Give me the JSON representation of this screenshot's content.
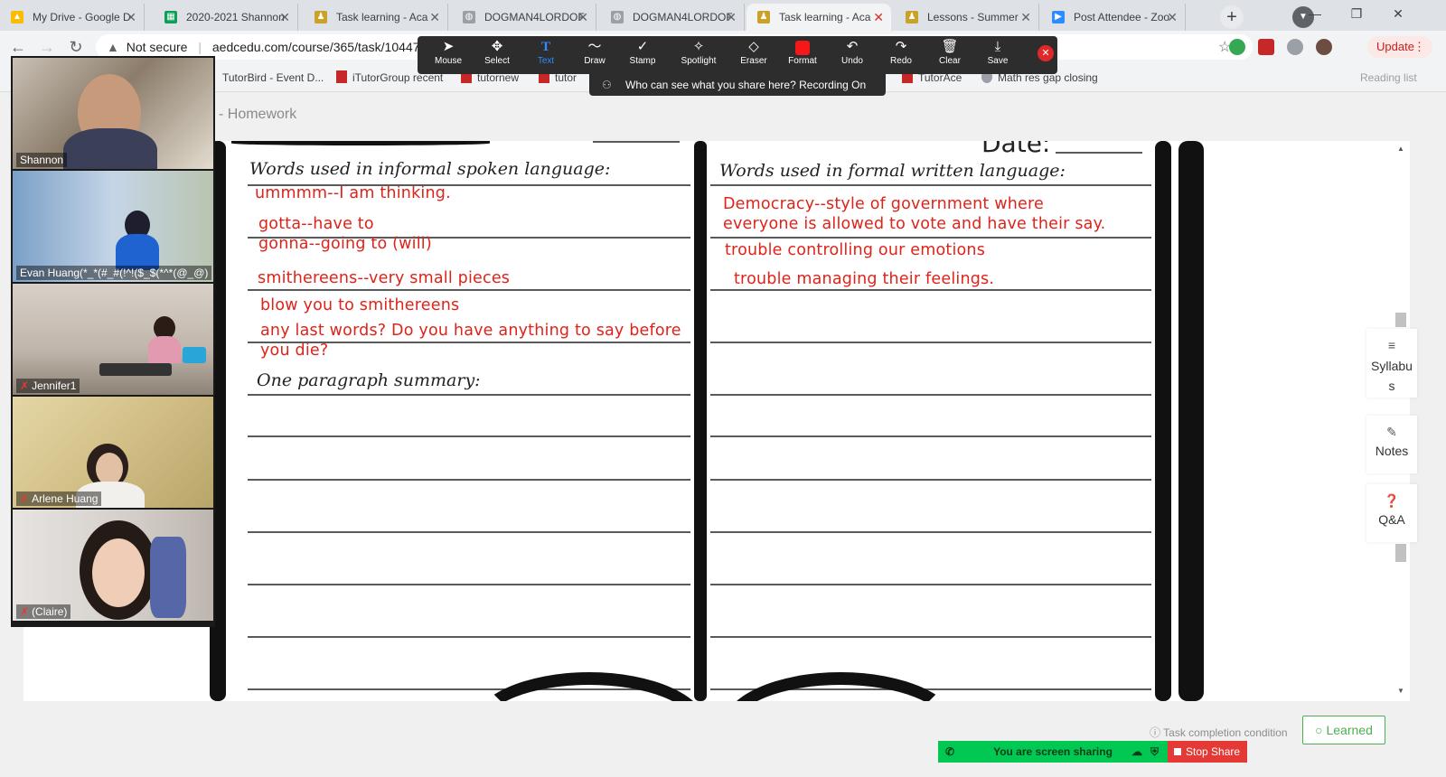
{
  "browser": {
    "tabs": [
      {
        "title": "My Drive - Google D",
        "favicon": "google-drive-icon"
      },
      {
        "title": "2020-2021 Shannon",
        "favicon": "google-sheets-icon"
      },
      {
        "title": "Task learning - Aca",
        "favicon": "aedc-icon"
      },
      {
        "title": "DOGMAN4LORDOF",
        "favicon": "globe-icon"
      },
      {
        "title": "DOGMAN4LORDOF",
        "favicon": "globe-icon"
      },
      {
        "title": "Task learning - Aca",
        "favicon": "aedc-icon",
        "active": true
      },
      {
        "title": "Lessons - Summer",
        "favicon": "aedc-icon"
      },
      {
        "title": "Post Attendee - Zoo",
        "favicon": "zoom-icon"
      }
    ],
    "security": "Not secure",
    "url": "aedcedu.com/course/365/task/10447/sl",
    "update_label": "Update",
    "bookmarks": [
      "TutorBird - Event D...",
      "iTutorGroup recent",
      "tutornew",
      "tutor",
      "TutorAce",
      "Math res gap closing"
    ],
    "reading_list": "Reading list"
  },
  "page": {
    "title": "- Homework",
    "task_condition": "Task completion condition",
    "learned_label": "Learned",
    "side_panel": [
      "Syllabus",
      "Notes",
      "Q&A"
    ]
  },
  "worksheet": {
    "date_label": "Date:",
    "left_heading": "Words used in informal spoken language:",
    "right_heading": "Words used in formal written language:",
    "summary_heading": "One paragraph summary:",
    "left_notes": [
      "ummmm--I am thinking.",
      "gotta--have to",
      "gonna--going to (will)",
      "smithereens--very small pieces",
      "blow you to smithereens",
      "any last words? Do you have anything to say before",
      "you die?"
    ],
    "right_notes": [
      "Democracy--style of government where",
      "everyone is allowed to vote and have their say.",
      "trouble controlling our emotions",
      "trouble managing their feelings."
    ],
    "annotation_color": "#e0231a"
  },
  "zoom": {
    "tools": [
      "Mouse",
      "Select",
      "Text",
      "Draw",
      "Stamp",
      "Spotlight",
      "Eraser",
      "Format",
      "Undo",
      "Redo",
      "Clear",
      "Save"
    ],
    "active_tool": "Text",
    "banner": "Who can see what you share here? Recording On",
    "sharing_label": "You are screen sharing",
    "stop_share_label": "Stop Share",
    "participants": [
      {
        "name": "Shannon",
        "muted": false
      },
      {
        "name": "Evan Huang(*_*(#_#(!^!($_$(*^*(@_@)",
        "muted": false,
        "speaking": true
      },
      {
        "name": "Jennifer1",
        "muted": true
      },
      {
        "name": "Arlene Huang",
        "muted": true
      },
      {
        "name": "(Claire)",
        "muted": true
      }
    ]
  }
}
